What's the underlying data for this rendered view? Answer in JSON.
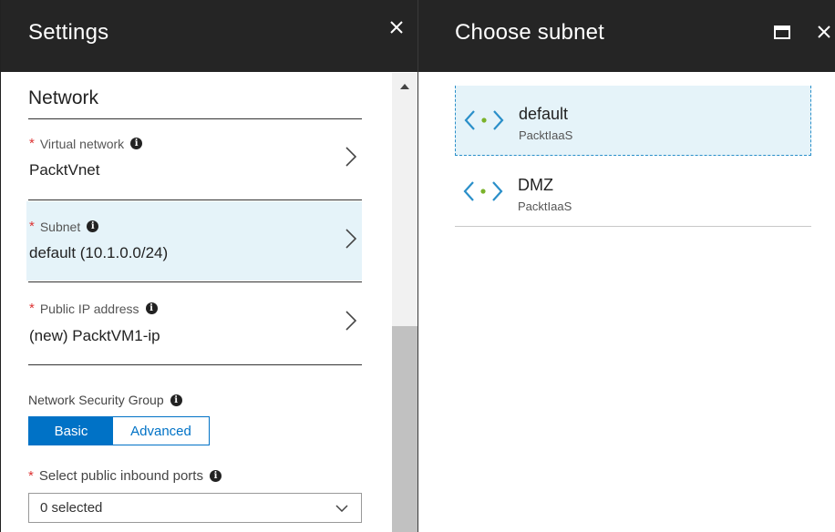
{
  "settings": {
    "title": "Settings",
    "section_title": "Network",
    "fields": [
      {
        "label": "Virtual network",
        "value": "PacktVnet",
        "required": "*"
      },
      {
        "label": "Subnet",
        "value": "default (10.1.0.0/24)",
        "required": "*"
      },
      {
        "label": "Public IP address",
        "value": "(new) PacktVM1-ip",
        "required": "*"
      }
    ],
    "nsg": {
      "label": "Network Security Group",
      "options": [
        "Basic",
        "Advanced"
      ],
      "selected": "Basic"
    },
    "ports": {
      "label": "Select public inbound ports",
      "required": "*",
      "value": "0 selected"
    },
    "info_glyph": "i",
    "close_glyph": "✕"
  },
  "choose_subnet": {
    "title": "Choose subnet",
    "close_glyph": "✕",
    "items": [
      {
        "name": "default",
        "vnet": "PacktIaaS",
        "selected": true
      },
      {
        "name": "DMZ",
        "vnet": "PacktIaaS",
        "selected": false
      }
    ]
  },
  "icons": {
    "subnet": "subnet-network-icon",
    "chevron": "chevron-right-icon",
    "maximize": "maximize-icon",
    "close": "close-icon"
  },
  "colors": {
    "header_bg": "#252525",
    "accent": "#0072c6",
    "selected_bg": "#e5f3f9",
    "required": "#d33333",
    "subnet_icon_blue": "#2a8fc9",
    "subnet_icon_dot": "#7ab22a"
  }
}
